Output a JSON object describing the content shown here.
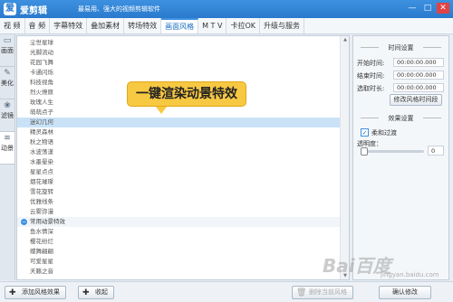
{
  "app": {
    "name": "爱剪辑",
    "slogan": "最易用、强大的视频剪辑软件",
    "logo_glyph": "爱"
  },
  "window_buttons": [
    "—",
    "□",
    "✕"
  ],
  "menu_tabs": [
    {
      "label": "视 频",
      "active": false
    },
    {
      "label": "音 频",
      "active": false
    },
    {
      "label": "字幕特效",
      "active": false
    },
    {
      "label": "叠加素材",
      "active": false
    },
    {
      "label": "转场特效",
      "active": false
    },
    {
      "label": "画面风格",
      "active": true
    },
    {
      "label": "M T V",
      "active": false
    },
    {
      "label": "卡拉OK",
      "active": false
    },
    {
      "label": "升级与服务",
      "active": false
    }
  ],
  "side_tabs": [
    {
      "label": "画面",
      "icon": "▭",
      "active": false
    },
    {
      "label": "美化",
      "icon": "✎",
      "active": false
    },
    {
      "label": "滤镜",
      "icon": "❀",
      "active": false
    },
    {
      "label": "动景",
      "icon": "≋",
      "active": true
    }
  ],
  "list_top": [
    "尘世星球",
    "光脚流动",
    "花园飞舞",
    "卡通闪烁",
    "科技视角",
    "烈火燎原",
    "玫瑰人生",
    "萌萌点子",
    "迷幻几何",
    "精灵森林",
    "秋之物语",
    "水波荡漾",
    "水墨晕染",
    "星星点点",
    "烟花璀璨",
    "雪花旋转",
    "优雅线条",
    "云雾弥漫"
  ],
  "selected_item": "迷幻几何",
  "group_header": "常用动景特效",
  "list_bottom": [
    "鱼水情深",
    "樱花纷烂",
    "蝶舞翩翩",
    "可爱星星",
    "天籁之音"
  ],
  "callout": "一键渲染动景特效",
  "right_panel": {
    "time_section": "时间设置",
    "start_label": "开始时间:",
    "start_value": "00:00:00.000",
    "end_label": "结束时间:",
    "end_value": "00:00:00.000",
    "duration_label": "选取时长:",
    "duration_value": "00:00:00.000",
    "modify_time_button": "修改风格时间段",
    "effect_section": "效果设置",
    "soft_transition_label": "柔和过渡",
    "soft_transition_checked": true,
    "opacity_label": "透明度：",
    "opacity_value": "0"
  },
  "bottom": {
    "add_button": "添加风格效果",
    "favorite_button": "收起",
    "delete_button": "删除当前风格",
    "confirm_button": "确认修改"
  },
  "watermark": "Bai百度",
  "watermark_sub": "jingyan.baidu.com"
}
